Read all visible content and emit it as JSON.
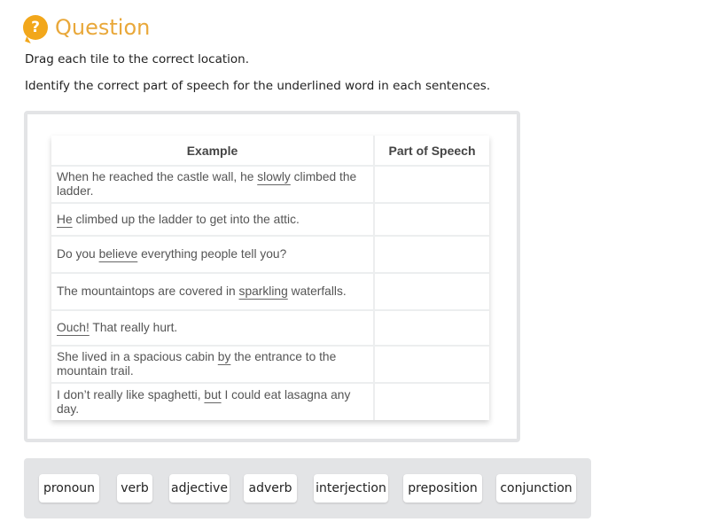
{
  "header": {
    "icon": "question-mark-icon",
    "icon_glyph": "?",
    "title": "Question",
    "accent_color": "#f2a71b"
  },
  "instructions": [
    "Drag each tile to the correct location.",
    "Identify the correct part of speech for the underlined word in each sentences."
  ],
  "table": {
    "headers": {
      "example": "Example",
      "part_of_speech": "Part of Speech"
    },
    "rows": [
      {
        "before": "When he reached the castle wall, he ",
        "underlined": "slowly",
        "after": " climbed the ladder.",
        "answer": ""
      },
      {
        "before": "",
        "underlined": "He",
        "after": " climbed up the ladder to get into the attic.",
        "answer": ""
      },
      {
        "before": "Do you ",
        "underlined": "believe",
        "after": " everything people tell you?",
        "answer": ""
      },
      {
        "before": "The mountaintops are covered in ",
        "underlined": "sparkling",
        "after": " waterfalls.",
        "answer": ""
      },
      {
        "before": "",
        "underlined": "Ouch!",
        "after": " That really hurt.",
        "answer": ""
      },
      {
        "before": "She lived in a spacious cabin ",
        "underlined": "by",
        "after": " the entrance to the mountain trail.",
        "answer": ""
      },
      {
        "before": "I don’t really like spaghetti, ",
        "underlined": "but",
        "after": " I could eat lasagna any day.",
        "answer": ""
      }
    ]
  },
  "tiles": [
    "pronoun",
    "verb",
    "adjective",
    "adverb",
    "interjection",
    "preposition",
    "conjunction"
  ]
}
